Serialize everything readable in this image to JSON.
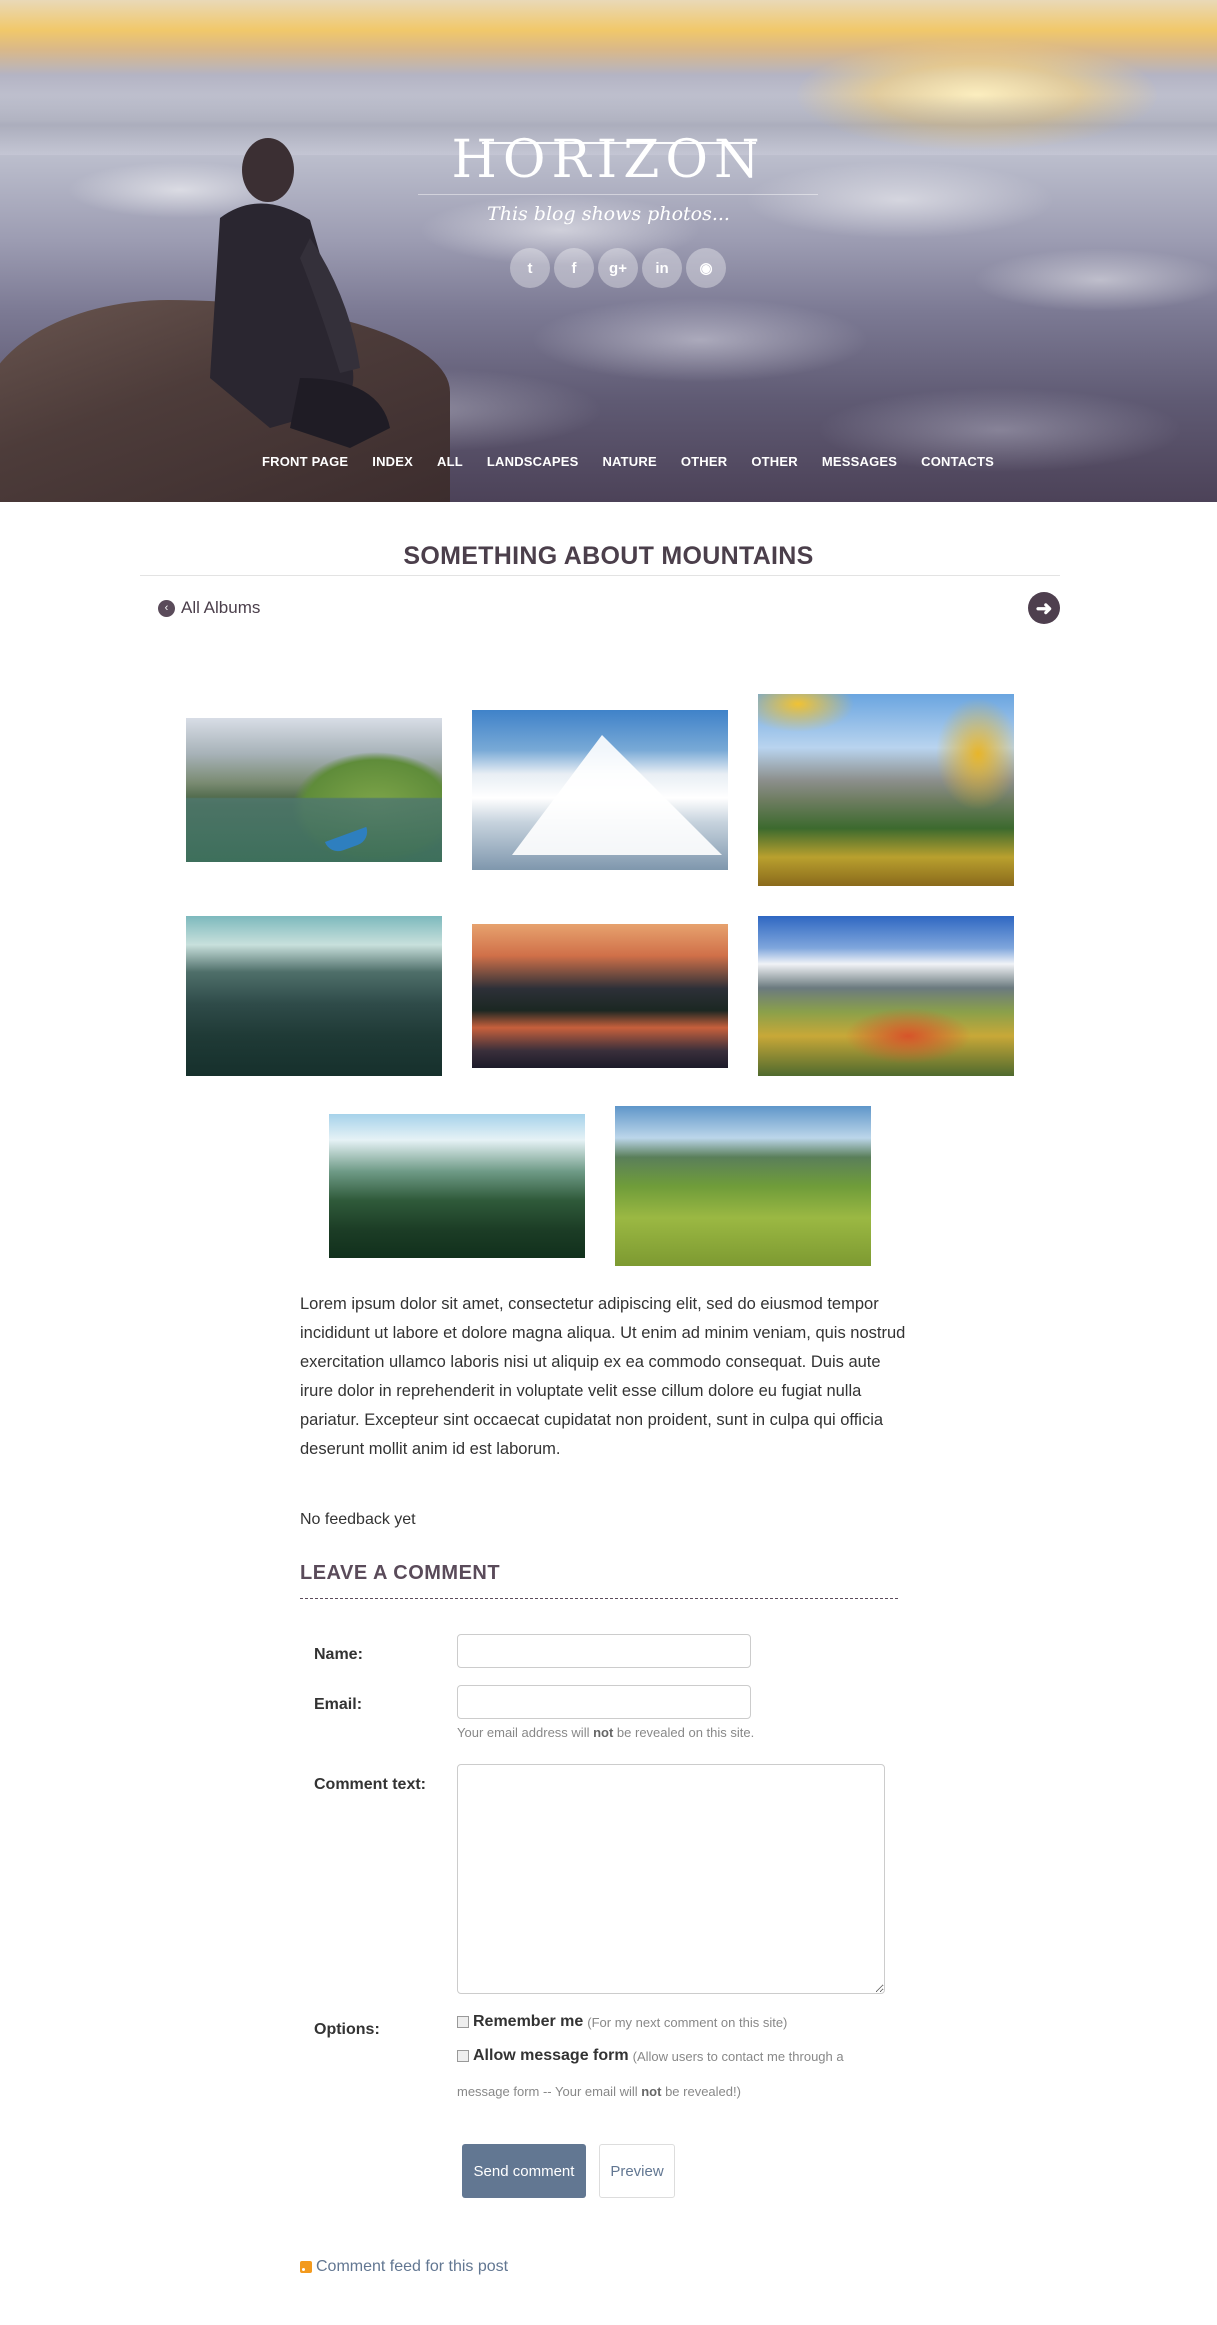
{
  "header": {
    "logo": "HORIZON",
    "tagline": "This blog shows photos...",
    "social": [
      {
        "icon": "twitter-icon",
        "glyph": "t"
      },
      {
        "icon": "facebook-icon",
        "glyph": "f"
      },
      {
        "icon": "google-plus-icon",
        "glyph": "g+"
      },
      {
        "icon": "linkedin-icon",
        "glyph": "in"
      },
      {
        "icon": "github-icon",
        "glyph": "◉"
      }
    ],
    "nav": [
      "FRONT PAGE",
      "INDEX",
      "ALL",
      "LANDSCAPES",
      "NATURE",
      "OTHER",
      "OTHER",
      "MESSAGES",
      "CONTACTS"
    ]
  },
  "post": {
    "title": "SOMETHING ABOUT MOUNTAINS",
    "all_albums": "All Albums",
    "all_albums_icon": "chevron-left-circle-icon",
    "next_icon": "arrow-right-circle-icon",
    "body": "Lorem ipsum dolor sit amet, consectetur adipiscing elit, sed do eiusmod tempor incididunt ut labore et dolore magna aliqua. Ut enim ad minim veniam, quis nostrud exercitation ullamco laboris nisi ut aliquip ex ea commodo consequat. Duis aute irure dolor in reprehenderit in voluptate velit esse cillum dolore eu fugiat nulla pariatur. Excepteur sint occaecat cupidatat non proident, sunt in culpa qui officia deserunt mollit anim id est laborum."
  },
  "comments": {
    "no_feedback": "No feedback yet",
    "leave_title": "LEAVE A COMMENT",
    "name_label": "Name:",
    "email_label": "Email:",
    "email_hint_pre": "Your email address will ",
    "email_hint_bold": "not",
    "email_hint_post": " be revealed on this site.",
    "comment_label": "Comment text:",
    "options_label": "Options:",
    "remember_label": "Remember me",
    "remember_hint": "(For my next comment on this site)",
    "allow_label": "Allow message form",
    "allow_hint": "(Allow users to contact me through a",
    "allow_hint2_pre": "message form -- Your email will ",
    "allow_hint2_bold": "not",
    "allow_hint2_post": " be revealed!)",
    "send_button": "Send comment",
    "preview_button": "Preview",
    "name_value": "",
    "email_value": "",
    "comment_value": ""
  },
  "footer": {
    "feed_link": "Comment feed for this post",
    "feed_icon": "rss-icon"
  },
  "colors": {
    "accent": "#627792",
    "title": "#4b3f4b",
    "rss": "#f39a1e"
  }
}
